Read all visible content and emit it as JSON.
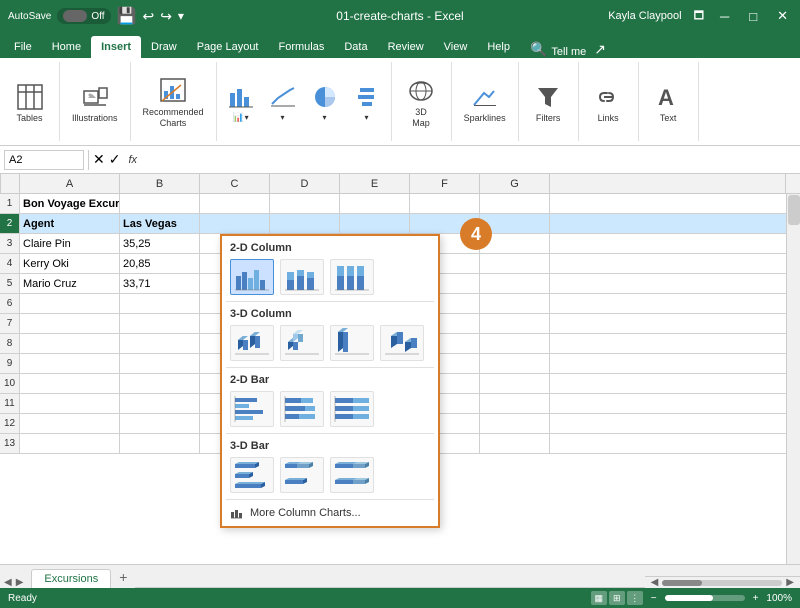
{
  "titlebar": {
    "autosave_label": "AutoSave",
    "autosave_state": "Off",
    "filename": "01-create-charts - Excel",
    "user": "Kayla Claypool"
  },
  "ribbon": {
    "tabs": [
      "File",
      "Home",
      "Insert",
      "Draw",
      "Page Layout",
      "Formulas",
      "Data",
      "Review",
      "View",
      "Help"
    ],
    "active_tab": "Insert",
    "groups": {
      "tables": "Tables",
      "illustrations": "Illustrations",
      "recommended_charts": "Recommended\nCharts",
      "charts": "Charts",
      "threed_map": "3D\nMap",
      "sparklines": "Sparklines",
      "filters": "Filters",
      "links": "Links",
      "text": "Text"
    }
  },
  "formula_bar": {
    "name_box": "A2",
    "formula": ""
  },
  "spreadsheet": {
    "columns": [
      "A",
      "B",
      "C",
      "D",
      "E",
      "F",
      "G"
    ],
    "rows": [
      [
        "1",
        "Bon Voyage Excursions",
        "",
        "",
        "",
        "",
        "",
        ""
      ],
      [
        "2",
        "Agent",
        "Las Vegas",
        "",
        "",
        "",
        "",
        ""
      ],
      [
        "3",
        "Claire Pin",
        "35,25",
        "",
        "",
        "",
        "",
        ""
      ],
      [
        "4",
        "Kerry Oki",
        "20,85",
        "",
        "",
        "",
        "",
        ""
      ],
      [
        "5",
        "Mario Cruz",
        "33,71",
        "",
        "",
        "",
        "",
        ""
      ],
      [
        "6",
        "",
        "",
        "",
        "",
        "",
        "",
        ""
      ],
      [
        "7",
        "",
        "",
        "",
        "",
        "",
        "",
        ""
      ],
      [
        "8",
        "",
        "",
        "",
        "",
        "",
        "",
        ""
      ],
      [
        "9",
        "",
        "",
        "",
        "",
        "",
        "",
        ""
      ],
      [
        "10",
        "",
        "",
        "",
        "",
        "",
        "",
        ""
      ],
      [
        "11",
        "",
        "",
        "",
        "",
        "",
        "",
        ""
      ],
      [
        "12",
        "",
        "",
        "",
        "",
        "",
        "",
        ""
      ],
      [
        "13",
        "",
        "",
        "",
        "",
        "",
        "",
        ""
      ]
    ]
  },
  "chart_dropdown": {
    "sections": [
      {
        "title": "2-D Column",
        "icons": [
          "clustered-column",
          "stacked-column",
          "100pct-stacked-column"
        ]
      },
      {
        "title": "3-D Column",
        "icons": [
          "3d-clustered-column",
          "3d-stacked-column",
          "3d-100pct-column",
          "3d-column"
        ]
      },
      {
        "title": "2-D Bar",
        "icons": [
          "clustered-bar",
          "stacked-bar",
          "100pct-stacked-bar"
        ]
      },
      {
        "title": "3-D Bar",
        "icons": [
          "3d-clustered-bar",
          "3d-stacked-bar",
          "3d-100pct-bar"
        ]
      }
    ],
    "more_label": "More Column Charts..."
  },
  "step_badge": "4",
  "sheet_tabs": [
    "Excursions"
  ],
  "status_bar": {
    "ready": "Ready",
    "zoom": "100%"
  }
}
